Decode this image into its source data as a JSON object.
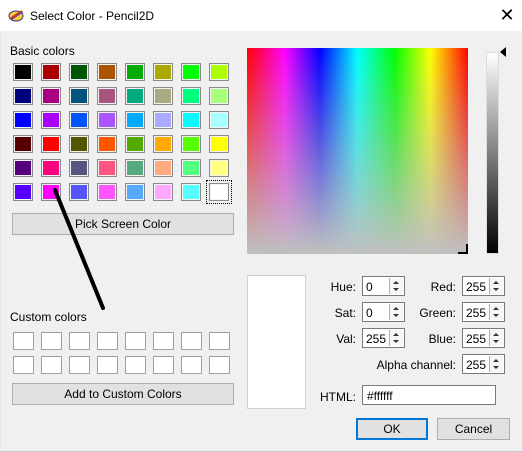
{
  "window": {
    "title": "Select Color - Pencil2D",
    "close_label": "✕"
  },
  "basic_colors": {
    "label": "Basic colors",
    "rows": [
      [
        "#000000",
        "#aa0000",
        "#005500",
        "#aa5500",
        "#00aa00",
        "#aaaa00",
        "#00ff00",
        "#aaff00"
      ],
      [
        "#00007f",
        "#aa007f",
        "#00557f",
        "#aa557f",
        "#00aa7f",
        "#aaaa7f",
        "#00ff7f",
        "#aaff7f"
      ],
      [
        "#0000ff",
        "#aa00ff",
        "#0055ff",
        "#aa55ff",
        "#00aaff",
        "#aaaaff",
        "#00ffff",
        "#aaffff"
      ],
      [
        "#550000",
        "#ff0000",
        "#555500",
        "#ff5500",
        "#55aa00",
        "#ffaa00",
        "#55ff00",
        "#ffff00"
      ],
      [
        "#55007f",
        "#ff007f",
        "#55557f",
        "#ff557f",
        "#55aa7f",
        "#ffaa7f",
        "#55ff7f",
        "#ffff7f"
      ],
      [
        "#5500ff",
        "#ff00ff",
        "#5555ff",
        "#ff55ff",
        "#55aaff",
        "#ffaaff",
        "#55ffff",
        "#ffffff"
      ]
    ],
    "selected": "#ffffff"
  },
  "pick_screen_label": "Pick Screen Color",
  "custom_colors": {
    "label": "Custom colors",
    "count": 16
  },
  "add_custom_label": "Add to Custom Colors",
  "fields": {
    "hue": {
      "label": "Hue:",
      "value": "0"
    },
    "sat": {
      "label": "Sat:",
      "value": "0"
    },
    "val": {
      "label": "Val:",
      "value": "255"
    },
    "red": {
      "label": "Red:",
      "value": "255"
    },
    "green": {
      "label": "Green:",
      "value": "255"
    },
    "blue": {
      "label": "Blue:",
      "value": "255"
    },
    "alpha": {
      "label": "Alpha channel:",
      "value": "255"
    },
    "html": {
      "label": "HTML:",
      "value": "#ffffff"
    }
  },
  "buttons": {
    "ok": "OK",
    "cancel": "Cancel"
  },
  "current_color": "#ffffff"
}
